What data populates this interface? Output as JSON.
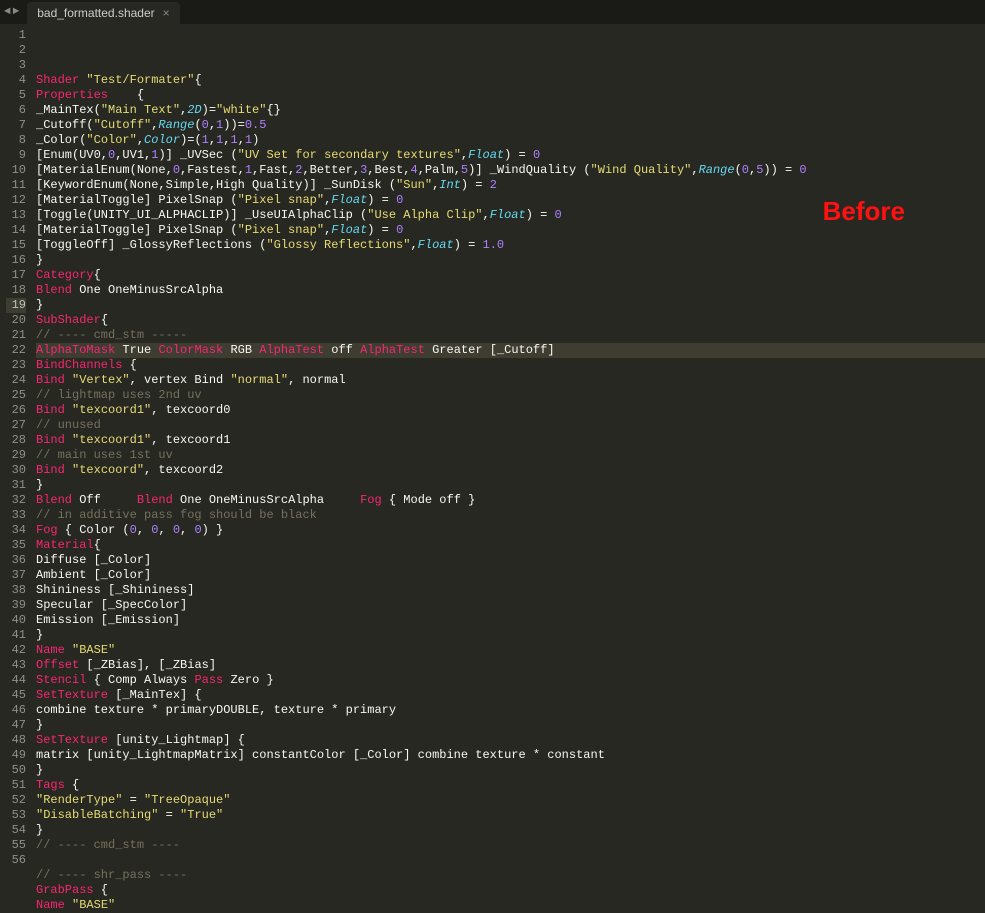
{
  "tab": {
    "filename": "bad_formatted.shader",
    "close": "×"
  },
  "annotation": "Before",
  "highlighted_line": 19,
  "lines": [
    [
      {
        "c": "kw",
        "t": "Shader"
      },
      {
        "c": "pl",
        "t": " "
      },
      {
        "c": "str",
        "t": "\"Test/Formater\""
      },
      {
        "c": "pl",
        "t": "{"
      }
    ],
    [
      {
        "c": "kw",
        "t": "Properties"
      },
      {
        "c": "pl",
        "t": "    {"
      }
    ],
    [
      {
        "c": "pl",
        "t": "_MainTex("
      },
      {
        "c": "str",
        "t": "\"Main Text\""
      },
      {
        "c": "pl",
        "t": ","
      },
      {
        "c": "typ",
        "t": "2D"
      },
      {
        "c": "pl",
        "t": ")="
      },
      {
        "c": "str",
        "t": "\"white\""
      },
      {
        "c": "pl",
        "t": "{}"
      }
    ],
    [
      {
        "c": "pl",
        "t": "_Cutoff("
      },
      {
        "c": "str",
        "t": "\"Cutoff\""
      },
      {
        "c": "pl",
        "t": ","
      },
      {
        "c": "typ",
        "t": "Range"
      },
      {
        "c": "pl",
        "t": "("
      },
      {
        "c": "num",
        "t": "0"
      },
      {
        "c": "pl",
        "t": ","
      },
      {
        "c": "num",
        "t": "1"
      },
      {
        "c": "pl",
        "t": "))="
      },
      {
        "c": "num",
        "t": "0.5"
      }
    ],
    [
      {
        "c": "pl",
        "t": "_Color("
      },
      {
        "c": "str",
        "t": "\"Color\""
      },
      {
        "c": "pl",
        "t": ","
      },
      {
        "c": "typ",
        "t": "Color"
      },
      {
        "c": "pl",
        "t": ")=("
      },
      {
        "c": "num",
        "t": "1"
      },
      {
        "c": "pl",
        "t": ","
      },
      {
        "c": "num",
        "t": "1"
      },
      {
        "c": "pl",
        "t": ","
      },
      {
        "c": "num",
        "t": "1"
      },
      {
        "c": "pl",
        "t": ","
      },
      {
        "c": "num",
        "t": "1"
      },
      {
        "c": "pl",
        "t": ")"
      }
    ],
    [
      {
        "c": "pl",
        "t": "[Enum(UV0,"
      },
      {
        "c": "num",
        "t": "0"
      },
      {
        "c": "pl",
        "t": ",UV1,"
      },
      {
        "c": "num",
        "t": "1"
      },
      {
        "c": "pl",
        "t": ")] _UVSec ("
      },
      {
        "c": "str",
        "t": "\"UV Set for secondary textures\""
      },
      {
        "c": "pl",
        "t": ","
      },
      {
        "c": "typ",
        "t": "Float"
      },
      {
        "c": "pl",
        "t": ") = "
      },
      {
        "c": "num",
        "t": "0"
      }
    ],
    [
      {
        "c": "pl",
        "t": "[MaterialEnum(None,"
      },
      {
        "c": "num",
        "t": "0"
      },
      {
        "c": "pl",
        "t": ",Fastest,"
      },
      {
        "c": "num",
        "t": "1"
      },
      {
        "c": "pl",
        "t": ",Fast,"
      },
      {
        "c": "num",
        "t": "2"
      },
      {
        "c": "pl",
        "t": ",Better,"
      },
      {
        "c": "num",
        "t": "3"
      },
      {
        "c": "pl",
        "t": ",Best,"
      },
      {
        "c": "num",
        "t": "4"
      },
      {
        "c": "pl",
        "t": ",Palm,"
      },
      {
        "c": "num",
        "t": "5"
      },
      {
        "c": "pl",
        "t": ")] _WindQuality ("
      },
      {
        "c": "str",
        "t": "\"Wind Quality\""
      },
      {
        "c": "pl",
        "t": ","
      },
      {
        "c": "typ",
        "t": "Range"
      },
      {
        "c": "pl",
        "t": "("
      },
      {
        "c": "num",
        "t": "0"
      },
      {
        "c": "pl",
        "t": ","
      },
      {
        "c": "num",
        "t": "5"
      },
      {
        "c": "pl",
        "t": ")) = "
      },
      {
        "c": "num",
        "t": "0"
      }
    ],
    [
      {
        "c": "pl",
        "t": "[KeywordEnum(None,Simple,High Quality)] _SunDisk ("
      },
      {
        "c": "str",
        "t": "\"Sun\""
      },
      {
        "c": "pl",
        "t": ","
      },
      {
        "c": "typ",
        "t": "Int"
      },
      {
        "c": "pl",
        "t": ") = "
      },
      {
        "c": "num",
        "t": "2"
      }
    ],
    [
      {
        "c": "pl",
        "t": "[MaterialToggle] PixelSnap ("
      },
      {
        "c": "str",
        "t": "\"Pixel snap\""
      },
      {
        "c": "pl",
        "t": ","
      },
      {
        "c": "typ",
        "t": "Float"
      },
      {
        "c": "pl",
        "t": ") = "
      },
      {
        "c": "num",
        "t": "0"
      }
    ],
    [
      {
        "c": "pl",
        "t": "[Toggle(UNITY_UI_ALPHACLIP)] _UseUIAlphaClip ("
      },
      {
        "c": "str",
        "t": "\"Use Alpha Clip\""
      },
      {
        "c": "pl",
        "t": ","
      },
      {
        "c": "typ",
        "t": "Float"
      },
      {
        "c": "pl",
        "t": ") = "
      },
      {
        "c": "num",
        "t": "0"
      }
    ],
    [
      {
        "c": "pl",
        "t": "[MaterialToggle] PixelSnap ("
      },
      {
        "c": "str",
        "t": "\"Pixel snap\""
      },
      {
        "c": "pl",
        "t": ","
      },
      {
        "c": "typ",
        "t": "Float"
      },
      {
        "c": "pl",
        "t": ") = "
      },
      {
        "c": "num",
        "t": "0"
      }
    ],
    [
      {
        "c": "pl",
        "t": "[ToggleOff] _GlossyReflections ("
      },
      {
        "c": "str",
        "t": "\"Glossy Reflections\""
      },
      {
        "c": "pl",
        "t": ","
      },
      {
        "c": "typ",
        "t": "Float"
      },
      {
        "c": "pl",
        "t": ") = "
      },
      {
        "c": "num",
        "t": "1.0"
      }
    ],
    [
      {
        "c": "pl",
        "t": "}"
      }
    ],
    [
      {
        "c": "kw",
        "t": "Category"
      },
      {
        "c": "pl",
        "t": "{"
      }
    ],
    [
      {
        "c": "kw",
        "t": "Blend"
      },
      {
        "c": "pl",
        "t": " One OneMinusSrcAlpha"
      }
    ],
    [
      {
        "c": "pl",
        "t": "}"
      }
    ],
    [
      {
        "c": "kw",
        "t": "SubShader"
      },
      {
        "c": "pl",
        "t": "{"
      }
    ],
    [
      {
        "c": "com",
        "t": "// ---- cmd_stm -----"
      }
    ],
    [
      {
        "c": "kw",
        "t": "AlphaToMask"
      },
      {
        "c": "pl",
        "t": " True "
      },
      {
        "c": "kw",
        "t": "ColorMask"
      },
      {
        "c": "pl",
        "t": " RGB "
      },
      {
        "c": "kw",
        "t": "AlphaTest"
      },
      {
        "c": "pl",
        "t": " off "
      },
      {
        "c": "kw",
        "t": "AlphaTest"
      },
      {
        "c": "pl",
        "t": " Greater [_Cutoff]"
      }
    ],
    [
      {
        "c": "kw",
        "t": "BindChannels"
      },
      {
        "c": "pl",
        "t": " {"
      }
    ],
    [
      {
        "c": "kw",
        "t": "Bind"
      },
      {
        "c": "pl",
        "t": " "
      },
      {
        "c": "str",
        "t": "\"Vertex\""
      },
      {
        "c": "pl",
        "t": ", vertex Bind "
      },
      {
        "c": "str",
        "t": "\"normal\""
      },
      {
        "c": "pl",
        "t": ", normal"
      }
    ],
    [
      {
        "c": "com",
        "t": "// lightmap uses 2nd uv"
      }
    ],
    [
      {
        "c": "kw",
        "t": "Bind"
      },
      {
        "c": "pl",
        "t": " "
      },
      {
        "c": "str",
        "t": "\"texcoord1\""
      },
      {
        "c": "pl",
        "t": ", texcoord0"
      }
    ],
    [
      {
        "c": "com",
        "t": "// unused"
      }
    ],
    [
      {
        "c": "kw",
        "t": "Bind"
      },
      {
        "c": "pl",
        "t": " "
      },
      {
        "c": "str",
        "t": "\"texcoord1\""
      },
      {
        "c": "pl",
        "t": ", texcoord1"
      }
    ],
    [
      {
        "c": "com",
        "t": "// main uses 1st uv"
      }
    ],
    [
      {
        "c": "kw",
        "t": "Bind"
      },
      {
        "c": "pl",
        "t": " "
      },
      {
        "c": "str",
        "t": "\"texcoord\""
      },
      {
        "c": "pl",
        "t": ", texcoord2"
      }
    ],
    [
      {
        "c": "pl",
        "t": "}"
      }
    ],
    [
      {
        "c": "kw",
        "t": "Blend"
      },
      {
        "c": "pl",
        "t": " Off     "
      },
      {
        "c": "kw",
        "t": "Blend"
      },
      {
        "c": "pl",
        "t": " One OneMinusSrcAlpha     "
      },
      {
        "c": "kw",
        "t": "Fog"
      },
      {
        "c": "pl",
        "t": " { Mode off }"
      }
    ],
    [
      {
        "c": "com",
        "t": "// in additive pass fog should be black"
      }
    ],
    [
      {
        "c": "kw",
        "t": "Fog"
      },
      {
        "c": "pl",
        "t": " { Color ("
      },
      {
        "c": "num",
        "t": "0"
      },
      {
        "c": "pl",
        "t": ", "
      },
      {
        "c": "num",
        "t": "0"
      },
      {
        "c": "pl",
        "t": ", "
      },
      {
        "c": "num",
        "t": "0"
      },
      {
        "c": "pl",
        "t": ", "
      },
      {
        "c": "num",
        "t": "0"
      },
      {
        "c": "pl",
        "t": ") }"
      }
    ],
    [
      {
        "c": "kw",
        "t": "Material"
      },
      {
        "c": "pl",
        "t": "{"
      }
    ],
    [
      {
        "c": "pl",
        "t": "Diffuse [_Color]"
      }
    ],
    [
      {
        "c": "pl",
        "t": "Ambient [_Color]"
      }
    ],
    [
      {
        "c": "pl",
        "t": "Shininess [_Shininess]"
      }
    ],
    [
      {
        "c": "pl",
        "t": "Specular [_SpecColor]"
      }
    ],
    [
      {
        "c": "pl",
        "t": "Emission [_Emission]"
      }
    ],
    [
      {
        "c": "pl",
        "t": "}"
      }
    ],
    [
      {
        "c": "kw",
        "t": "Name"
      },
      {
        "c": "pl",
        "t": " "
      },
      {
        "c": "str",
        "t": "\"BASE\""
      }
    ],
    [
      {
        "c": "kw",
        "t": "Offset"
      },
      {
        "c": "pl",
        "t": " [_ZBias], [_ZBias]"
      }
    ],
    [
      {
        "c": "kw",
        "t": "Stencil"
      },
      {
        "c": "pl",
        "t": " { Comp Always "
      },
      {
        "c": "kw",
        "t": "Pass"
      },
      {
        "c": "pl",
        "t": " Zero }"
      }
    ],
    [
      {
        "c": "kw",
        "t": "SetTexture"
      },
      {
        "c": "pl",
        "t": " [_MainTex] {"
      }
    ],
    [
      {
        "c": "pl",
        "t": "combine texture * primaryDOUBLE, texture * primary"
      }
    ],
    [
      {
        "c": "pl",
        "t": "}"
      }
    ],
    [
      {
        "c": "kw",
        "t": "SetTexture"
      },
      {
        "c": "pl",
        "t": " [unity_Lightmap] {"
      }
    ],
    [
      {
        "c": "pl",
        "t": "matrix [unity_LightmapMatrix] constantColor [_Color] combine texture * constant"
      }
    ],
    [
      {
        "c": "pl",
        "t": "}"
      }
    ],
    [
      {
        "c": "kw",
        "t": "Tags"
      },
      {
        "c": "pl",
        "t": " {"
      }
    ],
    [
      {
        "c": "str",
        "t": "\"RenderType\""
      },
      {
        "c": "pl",
        "t": " = "
      },
      {
        "c": "str",
        "t": "\"TreeOpaque\""
      }
    ],
    [
      {
        "c": "str",
        "t": "\"DisableBatching\""
      },
      {
        "c": "pl",
        "t": " = "
      },
      {
        "c": "str",
        "t": "\"True\""
      }
    ],
    [
      {
        "c": "pl",
        "t": "}"
      }
    ],
    [
      {
        "c": "com",
        "t": "// ---- cmd_stm ----"
      }
    ],
    [],
    [
      {
        "c": "com",
        "t": "// ---- shr_pass ----"
      }
    ],
    [
      {
        "c": "kw",
        "t": "GrabPass"
      },
      {
        "c": "pl",
        "t": " {"
      }
    ],
    [
      {
        "c": "kw",
        "t": "Name"
      },
      {
        "c": "pl",
        "t": " "
      },
      {
        "c": "str",
        "t": "\"BASE\""
      }
    ]
  ]
}
